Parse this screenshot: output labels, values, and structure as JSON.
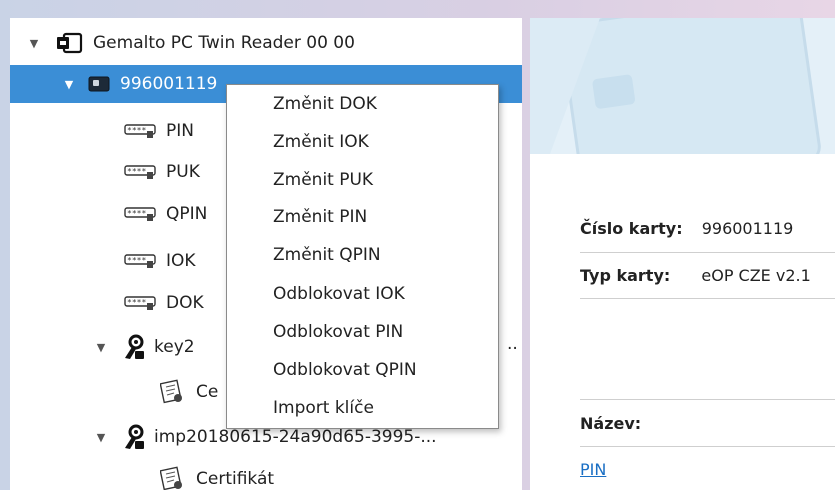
{
  "tree": {
    "reader_label": "Gemalto PC Twin Reader 00 00",
    "card_label": "996001119",
    "items": {
      "pin": "PIN",
      "puk": "PUK",
      "qpin": "QPIN",
      "iok": "IOK",
      "dok": "DOK",
      "key1": "key2",
      "key1_trail": "..",
      "cert1": "Ce",
      "key2": "imp20180615-24a90d65-3995-...",
      "cert2": "Certifikát"
    }
  },
  "context_menu": {
    "items": [
      "Změnit DOK",
      "Změnit IOK",
      "Změnit PUK",
      "Změnit PIN",
      "Změnit QPIN",
      "Odblokovat IOK",
      "Odblokovat PIN",
      "Odblokovat QPIN",
      "Import klíče"
    ]
  },
  "details": {
    "card_number_label": "Číslo karty:",
    "card_number_value": "996001119",
    "card_type_label": "Typ karty:",
    "card_type_value": "eOP CZE v2.1",
    "name_label": "Název:",
    "pin_link": "PIN"
  },
  "colors": {
    "selection": "#3b8ed6",
    "link": "#1a6fc4",
    "banner": "#e4f0f8"
  }
}
